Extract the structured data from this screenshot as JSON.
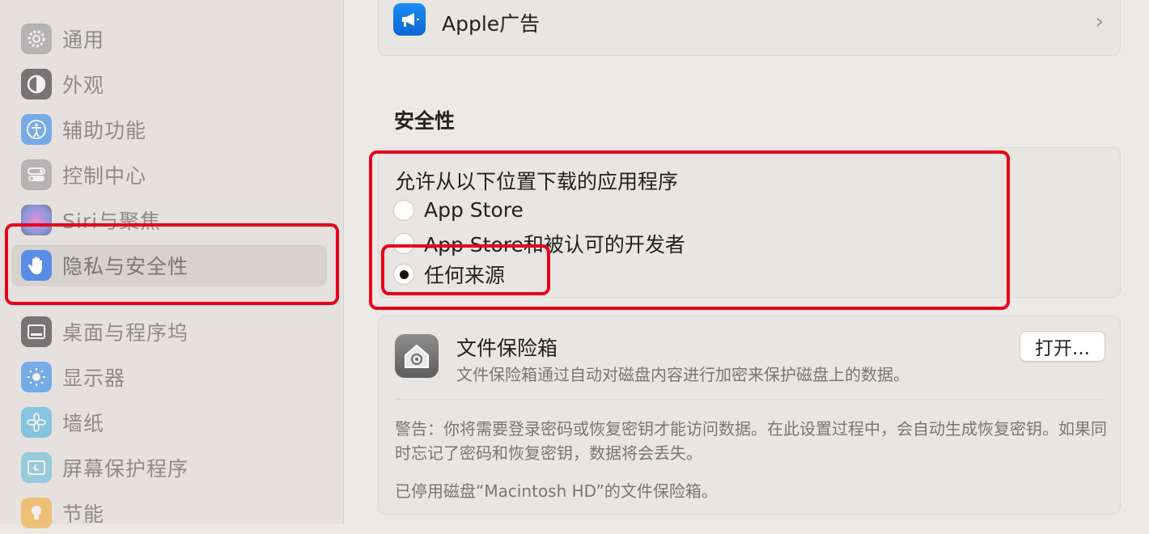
{
  "sidebar": {
    "items": [
      {
        "label": "通用",
        "icon": "gear-icon"
      },
      {
        "label": "外观",
        "icon": "appearance-icon"
      },
      {
        "label": "辅助功能",
        "icon": "accessibility-icon"
      },
      {
        "label": "控制中心",
        "icon": "control-center-icon"
      },
      {
        "label": "Siri与聚焦",
        "icon": "siri-icon"
      },
      {
        "label": "隐私与安全性",
        "icon": "hand-icon",
        "selected": true
      },
      {
        "label": "桌面与程序坞",
        "icon": "dock-icon"
      },
      {
        "label": "显示器",
        "icon": "display-icon"
      },
      {
        "label": "墙纸",
        "icon": "wallpaper-icon"
      },
      {
        "label": "屏幕保护程序",
        "icon": "screensaver-icon"
      },
      {
        "label": "节能",
        "icon": "energy-icon"
      }
    ]
  },
  "main": {
    "ads_label": "Apple广告",
    "security": {
      "section_title": "安全性",
      "heading": "允许从以下位置下载的应用程序",
      "options": [
        "App Store",
        "App Store和被认可的开发者",
        "任何来源"
      ],
      "selected_option": "任何来源"
    },
    "filevault": {
      "title": "文件保险箱",
      "description": "文件保险箱通过自动对磁盘内容进行加密来保护磁盘上的数据。",
      "open_button": "打开...",
      "warning": "警告：你将需要登录密码或恢复密钥才能访问数据。在此设置过程中，会自动生成恢复密钥。如果同时忘记了密码和恢复密钥，数据将会丢失。",
      "disabled_note": "已停用磁盘“Macintosh HD”的文件保险箱。"
    }
  },
  "colors": {
    "annotation_red": "#e8001a",
    "accent_blue": "#1a7ff0",
    "selection_gray": "#d7d2ce"
  }
}
